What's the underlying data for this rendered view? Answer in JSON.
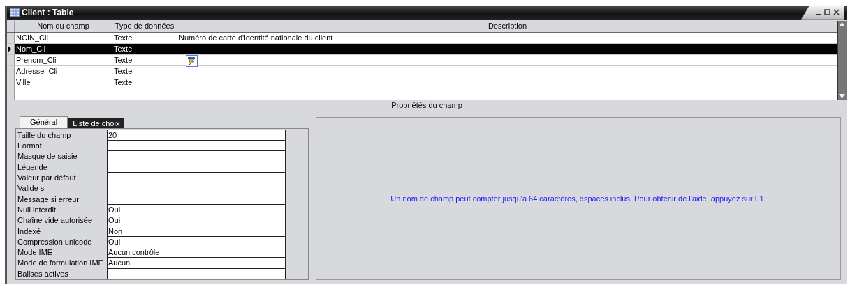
{
  "window": {
    "title": "Client : Table"
  },
  "table": {
    "columns": [
      "Nom du champ",
      "Type de données",
      "Description"
    ],
    "rows": [
      {
        "name": "NCIN_Cli",
        "type": "Texte",
        "description": "Numéro de carte d'identité nationale du client",
        "selected": false
      },
      {
        "name": "Nom_Cli",
        "type": "Texte",
        "selected": true
      },
      {
        "name": "Prenom_Cli",
        "type": "Texte",
        "selected": false
      },
      {
        "name": "Adresse_Cli",
        "type": "Texte",
        "selected": false
      },
      {
        "name": "Ville",
        "type": "Texte",
        "selected": false
      }
    ]
  },
  "properties": {
    "title": "Propriétés du champ",
    "tabs": [
      {
        "label": "Général",
        "selected": true
      },
      {
        "label": "Liste de choix",
        "selected": false
      }
    ],
    "fields": [
      {
        "label": "Taille du champ",
        "value": "20"
      },
      {
        "label": "Format"
      },
      {
        "label": "Masque de saisie"
      },
      {
        "label": "Légende"
      },
      {
        "label": "Valeur par défaut"
      },
      {
        "label": "Valide si"
      },
      {
        "label": "Message si erreur"
      },
      {
        "label": "Null interdit",
        "value": "Oui"
      },
      {
        "label": "Chaîne vide autorisée",
        "value": "Oui"
      },
      {
        "label": "Indexé",
        "value": "Non"
      },
      {
        "label": "Compression unicode",
        "value": "Oui"
      },
      {
        "label": "Mode IME",
        "value": "Aucun contrôle"
      },
      {
        "label": "Mode de formulation IME",
        "value": "Aucun"
      },
      {
        "label": "Balises actives"
      }
    ],
    "help": "Un nom de champ peut compter jusqu'à 64 caractères, espaces inclus. Pour obtenir de l'aide, appuyez sur F1."
  }
}
